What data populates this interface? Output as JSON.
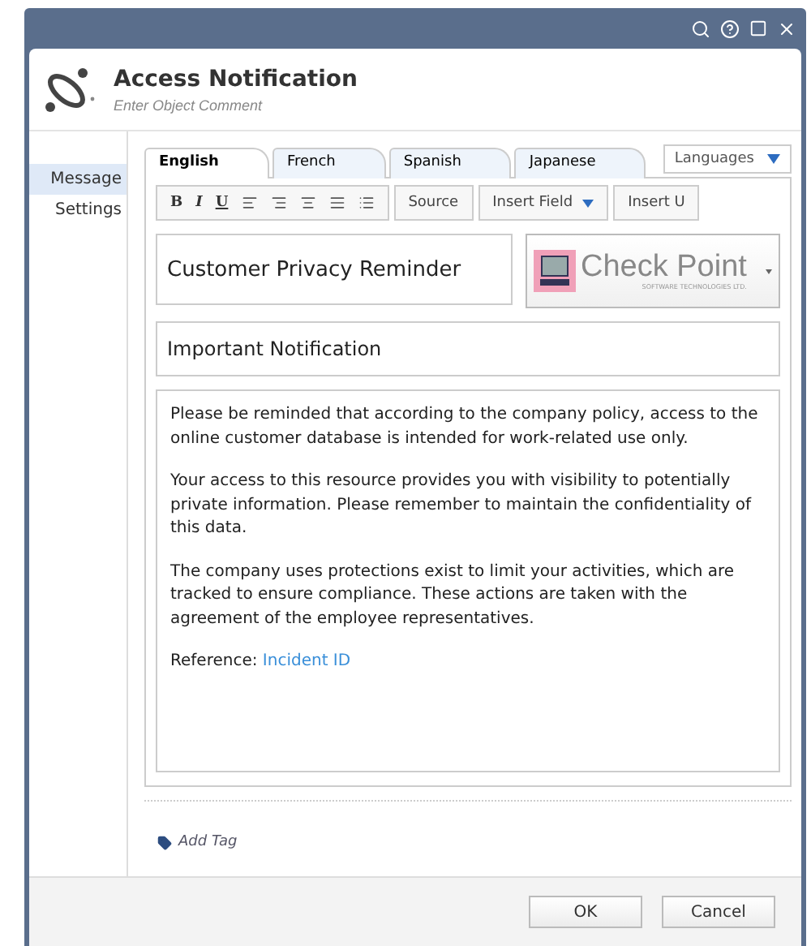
{
  "header": {
    "title": "Access Notification",
    "comment_placeholder": "Enter Object Comment"
  },
  "sidebar": {
    "items": [
      {
        "label": "Message",
        "selected": true
      },
      {
        "label": "Settings",
        "selected": false
      }
    ]
  },
  "tabs": [
    {
      "label": "English",
      "selected": true
    },
    {
      "label": "French",
      "selected": false
    },
    {
      "label": "Spanish",
      "selected": false
    },
    {
      "label": "Japanese",
      "selected": false
    }
  ],
  "languages_button": "Languages",
  "toolbar": {
    "format": [
      "B",
      "I",
      "U"
    ],
    "buttons": [
      {
        "label": "Source",
        "dropdown": false
      },
      {
        "label": "Insert Field",
        "dropdown": true
      },
      {
        "label": "Insert U",
        "dropdown": false
      }
    ]
  },
  "title_field": "Customer Privacy Reminder",
  "logo": {
    "name": "Check Point",
    "tagline": "SOFTWARE TECHNOLOGIES LTD."
  },
  "subject_field": "Important Notification",
  "body": {
    "paragraphs": [
      "Please be reminded that according to the company policy, access to the online customer database is intended for work-related use only.",
      "Your access to this resource provides you with visibility to potentially private information. Please remember to maintain the confidentiality of this data.",
      "The company uses protections exist to limit your activities, which are tracked to ensure compliance. These actions are taken with the agreement of the employee representatives."
    ],
    "reference_label": "Reference:",
    "reference_link": "Incident ID"
  },
  "add_tag": "Add Tag",
  "buttons": [
    "OK",
    "Cancel"
  ]
}
